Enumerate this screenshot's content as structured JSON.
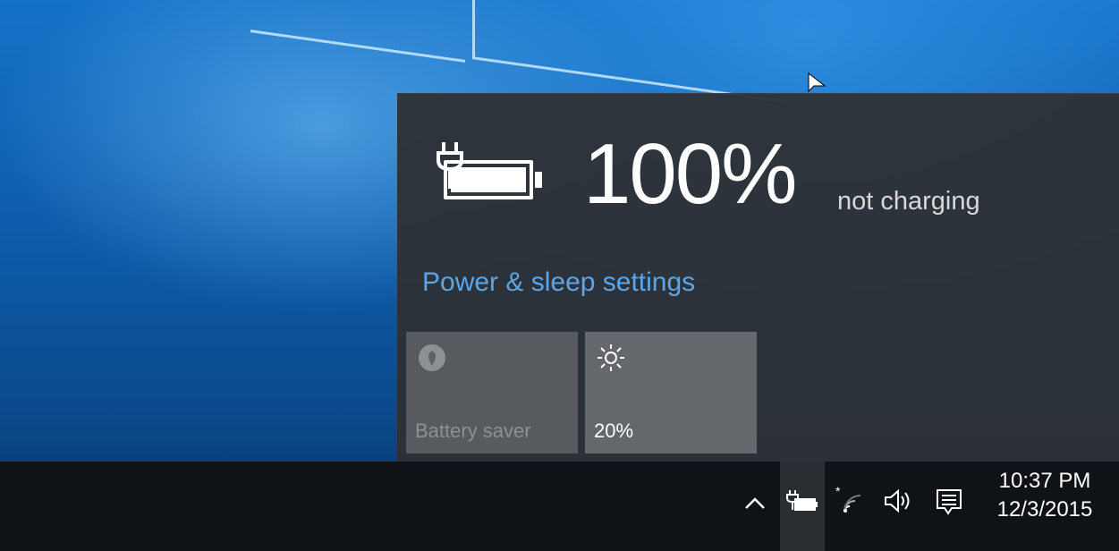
{
  "flyout": {
    "percent": "100%",
    "status": "not charging",
    "settings_link": "Power & sleep settings",
    "battery_level": 1.0,
    "tiles": [
      {
        "label": "Battery saver",
        "icon": "battery-saver-icon",
        "state": "off"
      },
      {
        "label": "20%",
        "icon": "brightness-icon",
        "state": "on"
      }
    ]
  },
  "taskbar": {
    "time": "10:37 PM",
    "date": "12/3/2015",
    "tray_icons": [
      "show-hidden-icons-chevron",
      "battery-icon",
      "wifi-icon",
      "volume-icon",
      "action-center-icon"
    ]
  },
  "colors": {
    "flyout_bg": "#2e3135",
    "link": "#5aa6e8",
    "taskbar_bg": "#0f1216",
    "desktop_accent": "#1572c8"
  }
}
